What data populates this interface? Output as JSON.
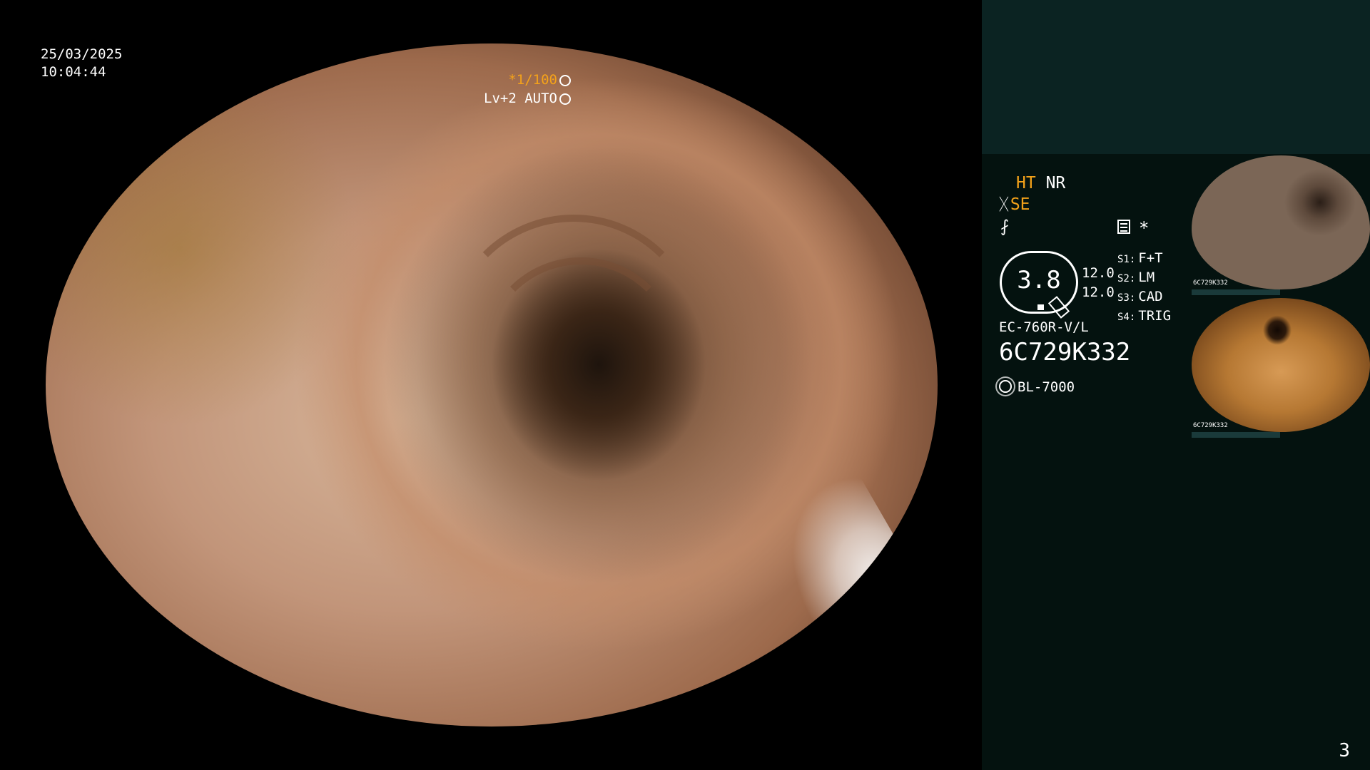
{
  "overlay": {
    "date": "25/03/2025",
    "time": "10:04:44",
    "shutter": "*1/100",
    "level": "Lv+2 AUTO"
  },
  "panel": {
    "ht": "HT",
    "nr": "NR",
    "se": "SE",
    "f_symbol": "⨏",
    "star": "*",
    "gauge_value": "3.8",
    "num1": "12.0",
    "num2": "12.0",
    "slots": [
      {
        "key": "S1:",
        "value": "F+T"
      },
      {
        "key": "S2:",
        "value": "LM"
      },
      {
        "key": "S3:",
        "value": "CAD"
      },
      {
        "key": "S4:",
        "value": "TRIG"
      }
    ],
    "scope_model": "EC-760R-V/L",
    "serial": "6C729K332",
    "light_source": "BL-7000"
  },
  "thumbnails": [
    {
      "label": "6C729K332"
    },
    {
      "label": "6C729K332"
    }
  ],
  "page_number": "3",
  "colors": {
    "accent_orange": "#f4a21a",
    "panel_bg": "#04120f",
    "panel_top_bg": "#0b2322"
  }
}
